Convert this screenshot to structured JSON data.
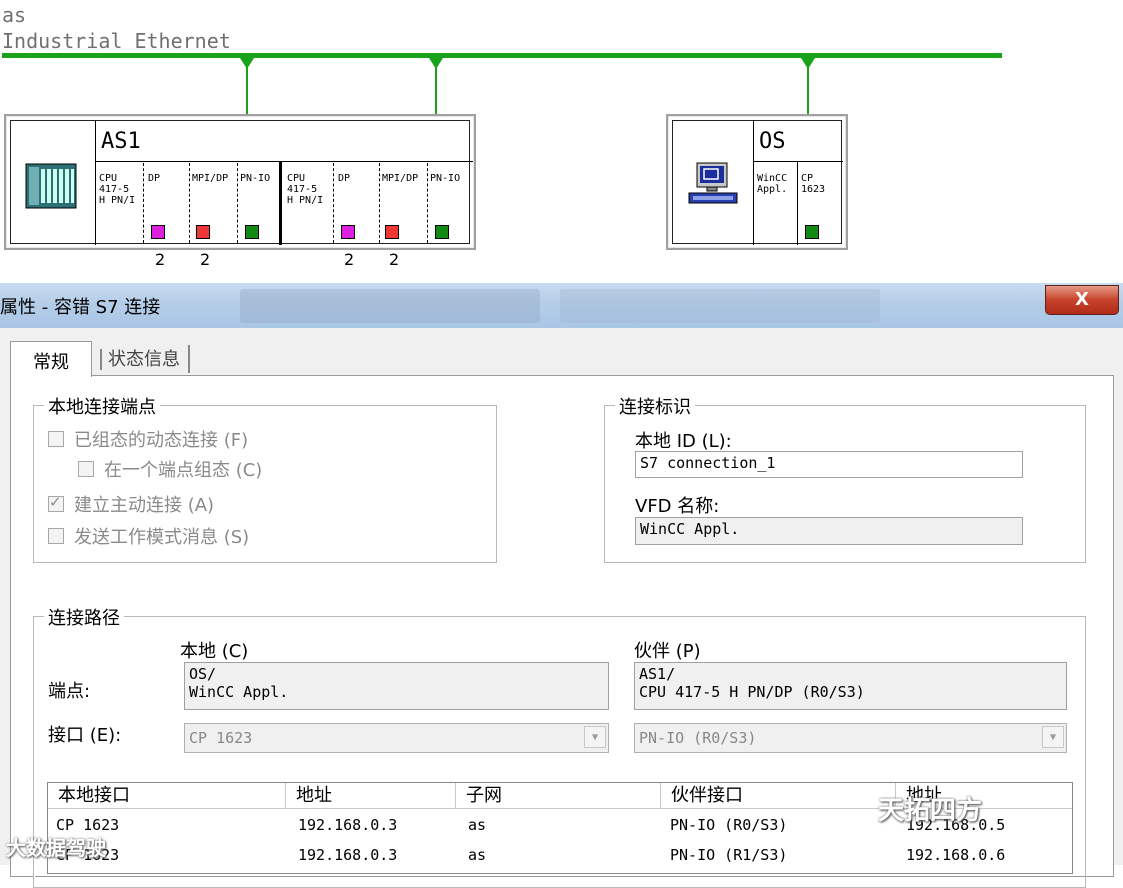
{
  "network": {
    "subnet_name": "as",
    "subnet_type": "Industrial Ethernet"
  },
  "stations": {
    "as1": {
      "name": "AS1",
      "modules_a": [
        "CPU\n417-5\nH PN/I",
        "DP",
        "MPI/DP",
        "PN-IO"
      ],
      "modules_b": [
        "CPU\n417-5\nH PN/I",
        "DP",
        "MPI/DP",
        "PN-IO"
      ],
      "numbers": [
        "2",
        "2",
        "2",
        "2"
      ]
    },
    "os": {
      "name": "OS",
      "modules": [
        "WinCC\nAppl.",
        "CP\n1623"
      ]
    }
  },
  "dialog": {
    "title": "属性 - 容错 S7 连接",
    "close_label": "X",
    "tabs": [
      "常规",
      "状态信息"
    ],
    "local_endpoint": {
      "title": "本地连接端点",
      "options": [
        {
          "label": "已组态的动态连接 (F)",
          "checked": false
        },
        {
          "label": "在一个端点组态 (C)",
          "checked": false
        },
        {
          "label": "建立主动连接 (A)",
          "checked": true
        },
        {
          "label": "发送工作模式消息 (S)",
          "checked": false
        }
      ]
    },
    "connection_id": {
      "title": "连接标识",
      "local_id_label": "本地 ID (L):",
      "local_id_value": "S7 connection_1",
      "vfd_label": "VFD 名称:",
      "vfd_value": "WinCC Appl."
    },
    "path": {
      "title": "连接路径",
      "local_header": "本地 (C)",
      "partner_header": "伙伴 (P)",
      "endpoint_label": "端点:",
      "local_endpoint": "OS/\nWinCC Appl.",
      "partner_endpoint": "AS1/\nCPU 417-5 H PN/DP (R0/S3)",
      "interface_label": "接口 (E):",
      "local_interface": "CP 1623",
      "partner_interface": "PN-IO (R0/S3)"
    },
    "table": {
      "headers": [
        "本地接口",
        "地址",
        "子网",
        "伙伴接口",
        "地址"
      ],
      "rows": [
        [
          "CP 1623",
          "192.168.0.3",
          "as",
          "PN-IO (R0/S3)",
          "192.168.0.5"
        ],
        [
          "CP 1623",
          "192.168.0.3",
          "as",
          "PN-IO (R1/S3)",
          "192.168.0.6"
        ]
      ]
    }
  },
  "watermarks": {
    "bottom_left": "大数据驾驶",
    "right": "天拓四方"
  }
}
